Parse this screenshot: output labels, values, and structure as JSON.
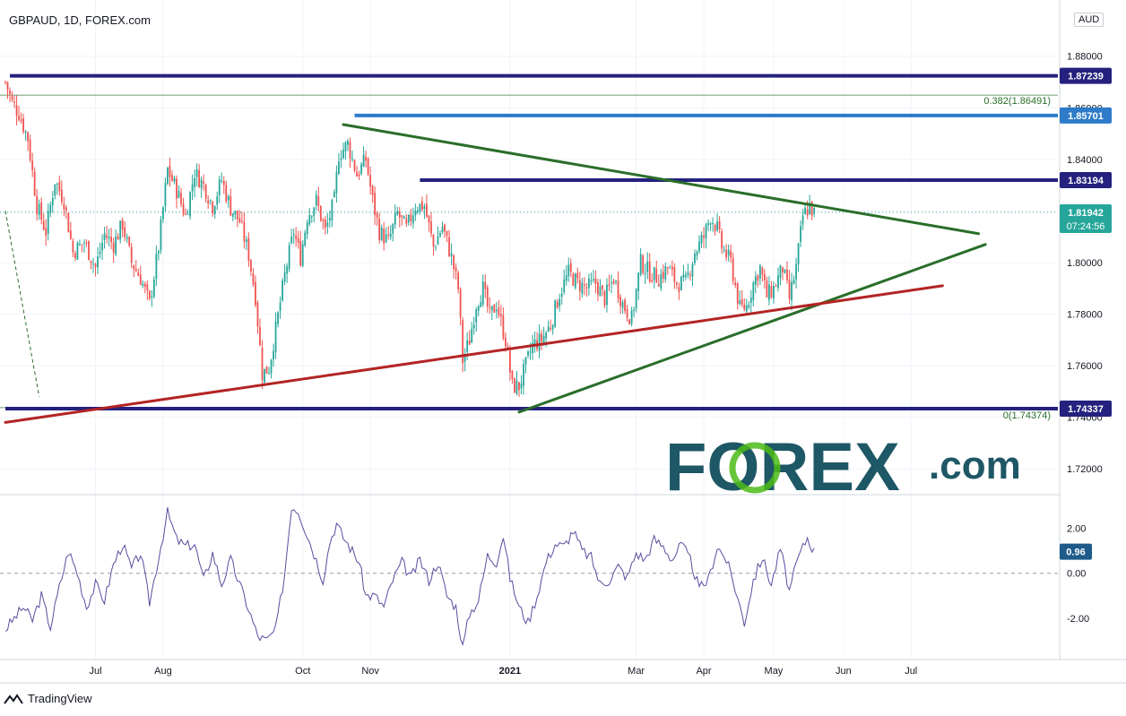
{
  "header": {
    "symbol_title": "GBPAUD, 1D, FOREX.com",
    "currency": "AUD"
  },
  "brand": {
    "watermark": "FOREX.com",
    "watermark_color": "#1e5765",
    "accent_green": "#4cbb17",
    "footer": "TradingView"
  },
  "colors": {
    "up": "#26a69a",
    "down": "#ef5350",
    "navy": "#25217e",
    "blue_level": "#2e7bc9",
    "trend_green": "#2a6e2a",
    "trend_red": "#b32424",
    "rsi_line": "#5d4a9e"
  },
  "chart_data": {
    "type": "candlestick",
    "price_axis": {
      "ylim": [
        1.71,
        1.899
      ],
      "ticks": [
        "1.88000",
        "1.86000",
        "1.84000",
        "1.82000",
        "1.80000",
        "1.78000",
        "1.76000",
        "1.74000",
        "1.72000"
      ],
      "tick_values": [
        1.88,
        1.86,
        1.84,
        1.82,
        1.8,
        1.78,
        1.76,
        1.74,
        1.72
      ]
    },
    "time_axis": {
      "labels": [
        "Jul",
        "Aug",
        "Oct",
        "Nov",
        "2021",
        "Mar",
        "Apr",
        "May",
        "Jun",
        "Jul"
      ],
      "label_days": [
        40,
        70,
        132,
        162,
        224,
        280,
        310,
        341,
        372,
        402
      ]
    },
    "horizontal_levels": [
      {
        "label": "1.87239",
        "value": 1.87239,
        "style": "navy",
        "from_day": 2
      },
      {
        "label": "1.85701",
        "value": 1.85701,
        "style": "blue",
        "from_day": 155
      },
      {
        "label": "1.83194",
        "value": 1.83194,
        "style": "navy",
        "from_day": 184
      },
      {
        "label": "1.74337",
        "value": 1.74337,
        "style": "navy",
        "from_day": 0
      }
    ],
    "current_price": {
      "label": "1.81942",
      "value": 1.81942,
      "countdown": "07:24:56"
    },
    "fibonacci": [
      {
        "label": "0.382(1.86491)",
        "value": 1.86491
      },
      {
        "label": "0(1.74374)",
        "value": 1.74374
      }
    ],
    "trendlines": [
      {
        "name": "upper-resistance",
        "color": "green",
        "points": [
          [
            150,
            1.8535
          ],
          [
            432,
            1.8112
          ]
        ]
      },
      {
        "name": "lower-support",
        "color": "green",
        "points": [
          [
            228,
            1.742
          ],
          [
            435,
            1.807
          ]
        ]
      },
      {
        "name": "long-support",
        "color": "red",
        "points": [
          [
            0,
            1.738
          ],
          [
            416,
            1.791
          ]
        ]
      }
    ],
    "fib_dashed": {
      "points": [
        [
          0,
          1.82
        ],
        [
          15,
          1.748
        ]
      ]
    },
    "price_anchors": [
      [
        0,
        1.87
      ],
      [
        3,
        1.862
      ],
      [
        6,
        1.858
      ],
      [
        10,
        1.848
      ],
      [
        14,
        1.822
      ],
      [
        18,
        1.812
      ],
      [
        22,
        1.832
      ],
      [
        26,
        1.824
      ],
      [
        30,
        1.804
      ],
      [
        35,
        1.808
      ],
      [
        40,
        1.798
      ],
      [
        44,
        1.811
      ],
      [
        48,
        1.807
      ],
      [
        52,
        1.815
      ],
      [
        56,
        1.8
      ],
      [
        60,
        1.794
      ],
      [
        64,
        1.784
      ],
      [
        68,
        1.806
      ],
      [
        72,
        1.836
      ],
      [
        76,
        1.828
      ],
      [
        80,
        1.818
      ],
      [
        84,
        1.835
      ],
      [
        88,
        1.83
      ],
      [
        92,
        1.822
      ],
      [
        96,
        1.832
      ],
      [
        100,
        1.821
      ],
      [
        104,
        1.816
      ],
      [
        108,
        1.803
      ],
      [
        111,
        1.787
      ],
      [
        114,
        1.757
      ],
      [
        117,
        1.759
      ],
      [
        120,
        1.774
      ],
      [
        124,
        1.795
      ],
      [
        128,
        1.812
      ],
      [
        131,
        1.802
      ],
      [
        134,
        1.818
      ],
      [
        138,
        1.824
      ],
      [
        142,
        1.812
      ],
      [
        146,
        1.824
      ],
      [
        148,
        1.842
      ],
      [
        152,
        1.846
      ],
      [
        156,
        1.834
      ],
      [
        160,
        1.84
      ],
      [
        163,
        1.824
      ],
      [
        166,
        1.812
      ],
      [
        170,
        1.808
      ],
      [
        174,
        1.819
      ],
      [
        178,
        1.813
      ],
      [
        182,
        1.822
      ],
      [
        186,
        1.822
      ],
      [
        190,
        1.806
      ],
      [
        194,
        1.814
      ],
      [
        198,
        1.802
      ],
      [
        201,
        1.79
      ],
      [
        203,
        1.762
      ],
      [
        206,
        1.77
      ],
      [
        209,
        1.784
      ],
      [
        212,
        1.79
      ],
      [
        215,
        1.779
      ],
      [
        218,
        1.784
      ],
      [
        222,
        1.77
      ],
      [
        225,
        1.752
      ],
      [
        228,
        1.752
      ],
      [
        231,
        1.76
      ],
      [
        234,
        1.768
      ],
      [
        238,
        1.77
      ],
      [
        242,
        1.776
      ],
      [
        246,
        1.788
      ],
      [
        250,
        1.796
      ],
      [
        254,
        1.792
      ],
      [
        258,
        1.79
      ],
      [
        262,
        1.792
      ],
      [
        266,
        1.786
      ],
      [
        270,
        1.794
      ],
      [
        274,
        1.784
      ],
      [
        278,
        1.778
      ],
      [
        282,
        1.8
      ],
      [
        286,
        1.796
      ],
      [
        290,
        1.794
      ],
      [
        294,
        1.798
      ],
      [
        298,
        1.792
      ],
      [
        302,
        1.792
      ],
      [
        306,
        1.804
      ],
      [
        310,
        1.81
      ],
      [
        313,
        1.818
      ],
      [
        316,
        1.813
      ],
      [
        318,
        1.806
      ],
      [
        322,
        1.8
      ],
      [
        326,
        1.782
      ],
      [
        329,
        1.783
      ],
      [
        332,
        1.792
      ],
      [
        335,
        1.798
      ],
      [
        338,
        1.787
      ],
      [
        341,
        1.79
      ],
      [
        345,
        1.798
      ],
      [
        348,
        1.786
      ],
      [
        351,
        1.798
      ],
      [
        354,
        1.818
      ],
      [
        357,
        1.822
      ],
      [
        359,
        1.819
      ]
    ],
    "oscillator": {
      "ylim": [
        -3.6,
        3.3
      ],
      "ticks": [
        "2.00",
        "0.00",
        "-2.00"
      ],
      "tick_values": [
        2,
        0,
        -2
      ],
      "current": "0.96",
      "current_value": 0.96,
      "anchors": [
        [
          0,
          -2.5
        ],
        [
          4,
          -2.0
        ],
        [
          8,
          -1.5
        ],
        [
          12,
          -2.1
        ],
        [
          16,
          -1.0
        ],
        [
          20,
          -2.4
        ],
        [
          24,
          -0.6
        ],
        [
          28,
          1.0
        ],
        [
          32,
          0.0
        ],
        [
          36,
          -1.5
        ],
        [
          40,
          -0.5
        ],
        [
          44,
          -1.2
        ],
        [
          48,
          0.4
        ],
        [
          52,
          1.3
        ],
        [
          56,
          0.2
        ],
        [
          60,
          0.9
        ],
        [
          64,
          -1.3
        ],
        [
          68,
          0.7
        ],
        [
          72,
          2.7
        ],
        [
          76,
          1.5
        ],
        [
          80,
          1.2
        ],
        [
          84,
          1.3
        ],
        [
          88,
          -0.3
        ],
        [
          92,
          0.9
        ],
        [
          96,
          -0.5
        ],
        [
          100,
          0.6
        ],
        [
          104,
          -0.5
        ],
        [
          108,
          -1.6
        ],
        [
          112,
          -2.8
        ],
        [
          116,
          -3.0
        ],
        [
          120,
          -2.5
        ],
        [
          124,
          0.0
        ],
        [
          127,
          3.0
        ],
        [
          130,
          2.8
        ],
        [
          134,
          1.7
        ],
        [
          138,
          0.6
        ],
        [
          141,
          -0.3
        ],
        [
          144,
          1.4
        ],
        [
          147,
          2.2
        ],
        [
          150,
          1.6
        ],
        [
          154,
          1.0
        ],
        [
          157,
          0.5
        ],
        [
          160,
          -1.0
        ],
        [
          164,
          -1.0
        ],
        [
          168,
          -1.5
        ],
        [
          172,
          -0.3
        ],
        [
          176,
          0.5
        ],
        [
          180,
          -0.2
        ],
        [
          184,
          0.6
        ],
        [
          188,
          -0.3
        ],
        [
          192,
          0.5
        ],
        [
          196,
          -1.0
        ],
        [
          200,
          -1.5
        ],
        [
          203,
          -3.3
        ],
        [
          206,
          -1.8
        ],
        [
          210,
          -1.2
        ],
        [
          214,
          0.8
        ],
        [
          218,
          0.5
        ],
        [
          221,
          1.7
        ],
        [
          224,
          -0.2
        ],
        [
          228,
          -1.5
        ],
        [
          232,
          -2.2
        ],
        [
          236,
          -1.0
        ],
        [
          240,
          0.5
        ],
        [
          244,
          1.3
        ],
        [
          248,
          1.2
        ],
        [
          252,
          1.9
        ],
        [
          256,
          1.0
        ],
        [
          260,
          0.7
        ],
        [
          264,
          -0.5
        ],
        [
          268,
          -0.3
        ],
        [
          272,
          0.3
        ],
        [
          276,
          -0.2
        ],
        [
          280,
          0.9
        ],
        [
          284,
          0.6
        ],
        [
          288,
          1.5
        ],
        [
          292,
          1.2
        ],
        [
          296,
          0.6
        ],
        [
          300,
          1.3
        ],
        [
          304,
          0.6
        ],
        [
          308,
          -0.7
        ],
        [
          312,
          -0.3
        ],
        [
          316,
          1.2
        ],
        [
          320,
          0.6
        ],
        [
          324,
          -0.7
        ],
        [
          328,
          -2.2
        ],
        [
          332,
          -0.3
        ],
        [
          336,
          0.7
        ],
        [
          340,
          -0.5
        ],
        [
          344,
          1.1
        ],
        [
          348,
          -0.8
        ],
        [
          352,
          0.7
        ],
        [
          356,
          1.6
        ],
        [
          359,
          0.96
        ]
      ]
    }
  }
}
